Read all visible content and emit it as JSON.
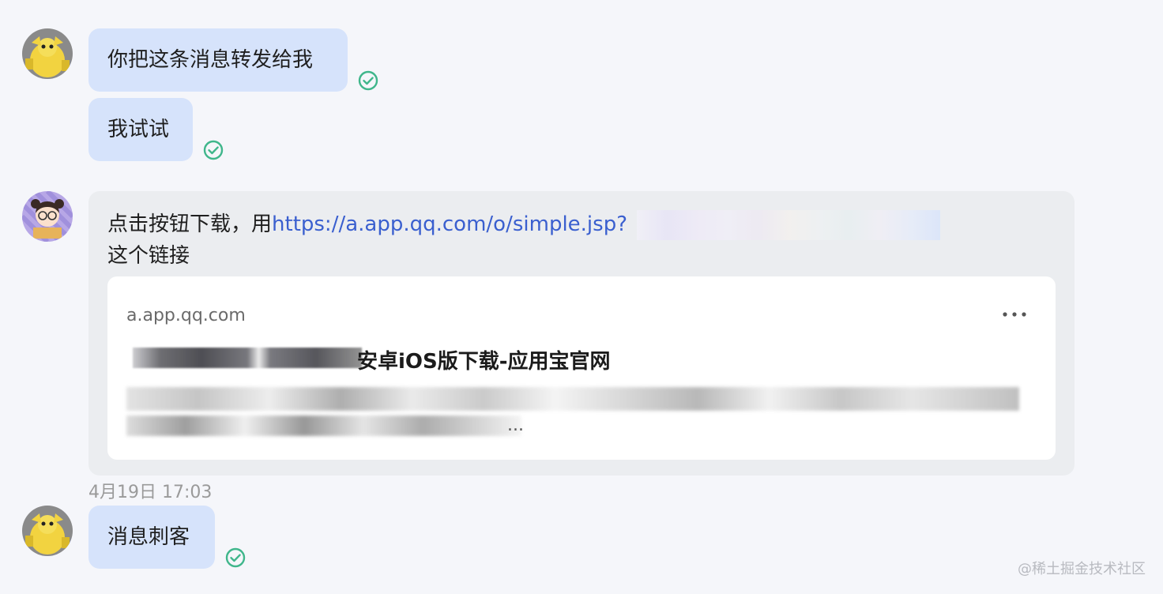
{
  "messages": [
    {
      "text": "你把这条消息转发给我",
      "status": "sent"
    },
    {
      "text": "我试试",
      "status": "sent"
    },
    {
      "text_prefix": "点击按钮下载，用",
      "link": "https://a.app.qq.com/o/simple.jsp?",
      "text_suffix": "这个链接",
      "preview": {
        "domain": "a.app.qq.com",
        "title_visible": "安卓iOS版下载-应用宝官网",
        "desc_tail": "..."
      }
    },
    {
      "text": "消息刺客",
      "status": "sent"
    }
  ],
  "timestamp": "4月19日 17:03",
  "watermark": "@稀土掘金技术社区",
  "icons": {
    "check": "check-circle-icon",
    "more": "more-dots-icon"
  },
  "colors": {
    "bubble": "#d6e3fb",
    "card": "#ebedf0",
    "check": "#3fb68b",
    "link": "#3a5fcf"
  }
}
